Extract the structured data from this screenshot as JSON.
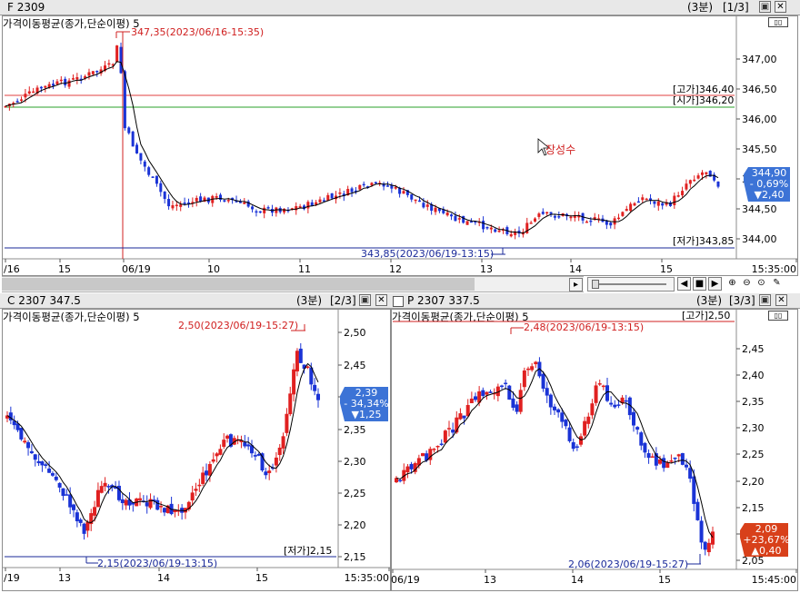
{
  "window_top": {
    "title": "F 2309",
    "period": "(3분)",
    "page": "[1/3]"
  },
  "window_c": {
    "title": "C 2307 347.5",
    "period": "(3분)",
    "page": "[2/3]"
  },
  "window_p": {
    "title": "P 2307 337.5",
    "period": "(3분)",
    "page": "[3/3]"
  },
  "ma_label": "가격이동평균(종가,단순이평) 5",
  "top_chart": {
    "y_ticks": [
      "347,00",
      "346,50",
      "346,00",
      "345,50",
      "345,00",
      "344,50",
      "344,00"
    ],
    "x_ticks": [
      "/16",
      "15",
      "06/19",
      "10",
      "11",
      "12",
      "13",
      "14",
      "15",
      "15:35:00"
    ],
    "high_marker": "347,35(2023/06/16-15:35)",
    "low_marker": "343,85(2023/06/19-13:15)",
    "high_line_label": "[고가]346,40",
    "open_line_label": "[시가]346,20",
    "low_line_label": "[저가]343,85",
    "annotation": "장성수",
    "current_price": "344,90",
    "change_pct": "- 0,69%",
    "change_val": "▼2,40",
    "colors": {
      "up": "#e02020",
      "down": "#1a33d6",
      "high_line": "#e04040",
      "open_line": "#2aa02a",
      "low_line": "#1a2a9a",
      "current_box": "#3c73d6"
    }
  },
  "c_chart": {
    "y_ticks": [
      "2,50",
      "2,45",
      "2,40",
      "2,35",
      "2,30",
      "2,25",
      "2,20",
      "2,15"
    ],
    "x_ticks": [
      "/19",
      "13",
      "14",
      "15",
      "15:35:00"
    ],
    "high_marker": "2,50(2023/06/19-15:27)",
    "low_marker": "2,15(2023/06/19-13:15)",
    "low_line_label": "[저가]2,15",
    "current_price": "2,39",
    "change_pct": "- 34,34%",
    "change_val": "▼1,25",
    "colors": {
      "current_box": "#3c73d6"
    }
  },
  "p_chart": {
    "y_ticks": [
      "2,45",
      "2,40",
      "2,35",
      "2,30",
      "2,25",
      "2,20",
      "2,15",
      "2,10",
      "2,05"
    ],
    "x_ticks": [
      "06/19",
      "13",
      "14",
      "15",
      "15:45:00"
    ],
    "high_marker": "2,48(2023/06/19-13:15)",
    "low_marker": "2,06(2023/06/19-15:27)",
    "high_line_label": "[고가]2,50",
    "current_price": "2,09",
    "change_pct": "+23,67%",
    "change_val": "▲0,40",
    "colors": {
      "current_box": "#d8401a"
    }
  }
}
